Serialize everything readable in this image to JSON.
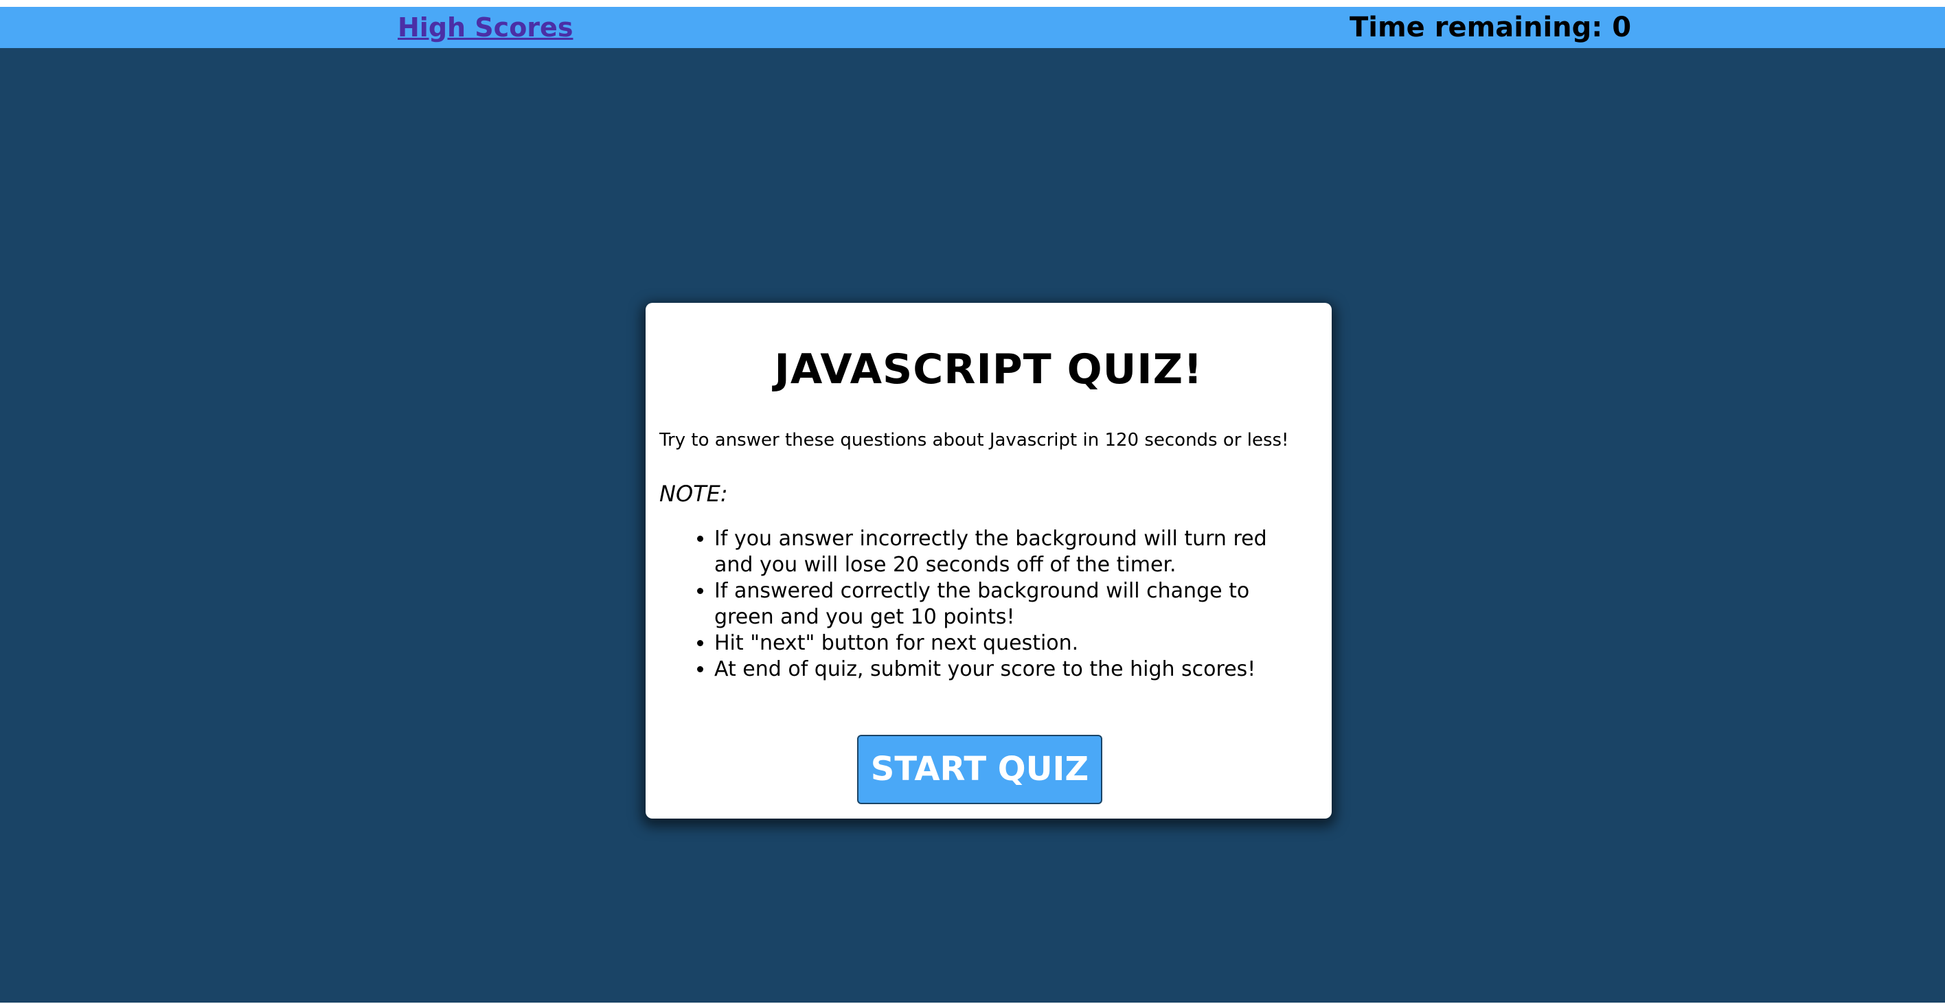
{
  "header": {
    "high_scores_link": "High Scores",
    "timer_label": "Time remaining: 0"
  },
  "quiz": {
    "title": "JAVASCRIPT QUIZ!",
    "intro": "Try to answer these questions about Javascript in 120 seconds or less!",
    "note_label": "NOTE:",
    "rules": [
      "If you answer incorrectly the background will turn red and you will lose 20 seconds off of the timer.",
      "If answered correctly the background will change to green and you get 10 points!",
      "Hit \"next\" button for next question.",
      "At end of quiz, submit your score to the high scores!"
    ],
    "start_button": "START QUIZ"
  },
  "colors": {
    "background": "#1a4466",
    "header_bar": "#4aa8f7",
    "link": "#4b2fa6",
    "button": "#4aa8f7",
    "card": "#ffffff"
  }
}
